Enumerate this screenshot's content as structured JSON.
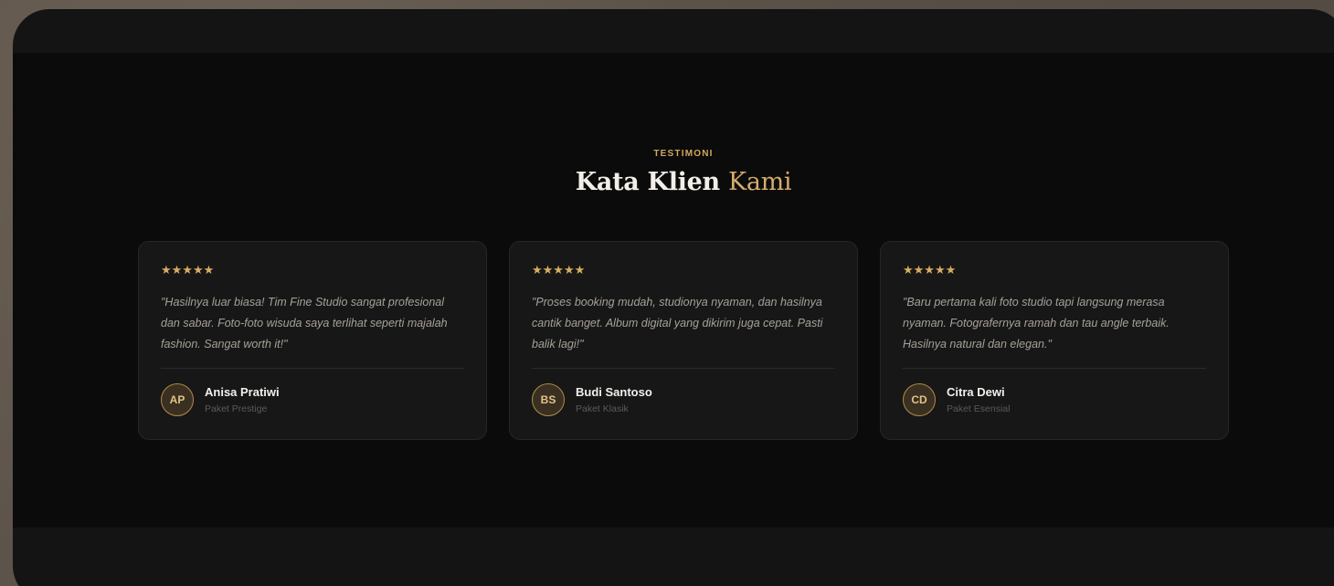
{
  "section": {
    "eyebrow": "TESTIMONI",
    "title_main": "Kata Klien ",
    "title_accent": "Kami"
  },
  "colors": {
    "accent": "#d4ad6a",
    "card_bg": "#171717",
    "section_bg": "#0b0b0b"
  },
  "testimonials": [
    {
      "rating": 5,
      "stars": "★★★★★",
      "quote": "\"Hasilnya luar biasa! Tim Fine Studio sangat profesional dan sabar. Foto-foto wisuda saya terlihat seperti majalah fashion. Sangat worth it!\"",
      "initials": "AP",
      "name": "Anisa Pratiwi",
      "package": "Paket Prestige"
    },
    {
      "rating": 5,
      "stars": "★★★★★",
      "quote": "\"Proses booking mudah, studionya nyaman, dan hasilnya cantik banget. Album digital yang dikirim juga cepat. Pasti balik lagi!\"",
      "initials": "BS",
      "name": "Budi Santoso",
      "package": "Paket Klasik"
    },
    {
      "rating": 5,
      "stars": "★★★★★",
      "quote": "\"Baru pertama kali foto studio tapi langsung merasa nyaman. Fotografernya ramah dan tau angle terbaik. Hasilnya natural dan elegan.\"",
      "initials": "CD",
      "name": "Citra Dewi",
      "package": "Paket Esensial"
    }
  ]
}
